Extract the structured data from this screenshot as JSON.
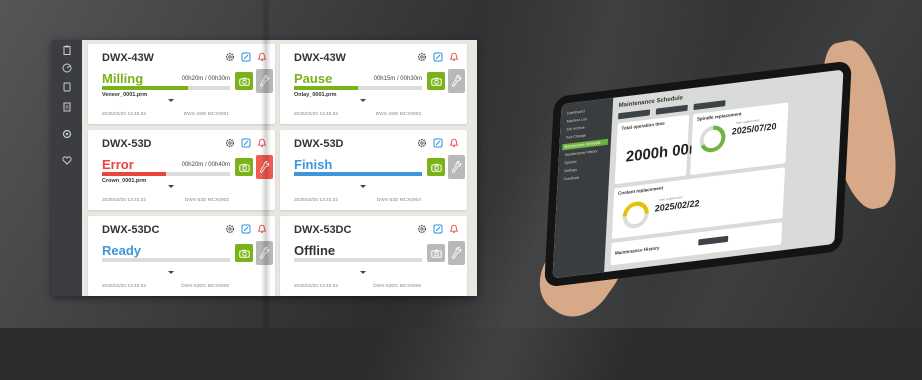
{
  "dashboard": {
    "cards": [
      {
        "name": "DWX-43W",
        "status": "Milling",
        "status_color": "#7ab317",
        "time": "00h20m / 00h30m",
        "progress": 0.67,
        "bar_color": "#7ab317",
        "file": "Veneer_0001.prm",
        "date": "2025/03/20 13:45:32",
        "model": "DWX-43W MCX0001",
        "wrench_color": "#7ab317",
        "wrench_bg": "#b9b9b9"
      },
      {
        "name": "DWX-43W",
        "status": "Pause",
        "status_color": "#7ab317",
        "time": "00h15m / 00h30m",
        "progress": 0.5,
        "bar_color": "#7ab317",
        "file": "Onlay_0001.prm",
        "date": "2025/03/20 13:45:32",
        "model": "DWX-43W MCX0003",
        "wrench_color": "#7ab317",
        "wrench_bg": "#b9b9b9"
      },
      {
        "name": "DWX-53D",
        "status": "Error",
        "status_color": "#e8463d",
        "time": "00h20m / 00h40m",
        "progress": 0.5,
        "bar_color": "#e8463d",
        "file": "Crown_0001.prm",
        "date": "2025/03/20 13:45:32",
        "model": "DWX-53D MCX0002",
        "wrench_color": "#7ab317",
        "wrench_bg": "#f15b50"
      },
      {
        "name": "DWX-53D",
        "status": "Finish",
        "status_color": "#3f95d9",
        "time": "",
        "progress": 1.0,
        "bar_color": "#3f95d9",
        "file": "",
        "date": "2025/03/20 13:45:32",
        "model": "DWX-53D MCX0004",
        "wrench_color": "#7ab317",
        "wrench_bg": "#b9b9b9"
      },
      {
        "name": "DWX-53DC",
        "status": "Ready",
        "status_color": "#3f95d9",
        "time": "",
        "progress": 0,
        "bar_color": "#3f95d9",
        "file": "",
        "date": "2025/03/20 13:45:32",
        "model": "DWX-53DC MCX0005",
        "wrench_color": "#7ab317",
        "wrench_bg": "#b9b9b9"
      },
      {
        "name": "DWX-53DC",
        "status": "Offline",
        "status_color": "#333333",
        "time": "",
        "progress": 0,
        "bar_color": "#cccccc",
        "file": "",
        "date": "2025/03/20 13:45:32",
        "model": "DWX-53DC MCX0006",
        "wrench_color": "#b9b9b9",
        "wrench_bg": "#b9b9b9"
      }
    ]
  },
  "tablet": {
    "title": "Maintenance Schedule",
    "nav": [
      "Dashboard",
      "Machine List",
      "Job Archive",
      "Tool Change",
      "Maintenance Schedule",
      "Maintenance History",
      "Options",
      "Settings",
      "Feedback"
    ],
    "active_nav": "Maintenance Schedule",
    "total_label": "Total operation time",
    "total_value": "2000h 00m",
    "spindle_label": "Spindle replacement",
    "spindle_date": "2025/07/20",
    "spindle_next_label": "Next replacement",
    "coolant_label": "Coolant replacement",
    "coolant_date": "2025/02/22",
    "coolant_next_label": "Next replacement",
    "history_label": "Maintenance History",
    "accent": "#6db33f"
  }
}
